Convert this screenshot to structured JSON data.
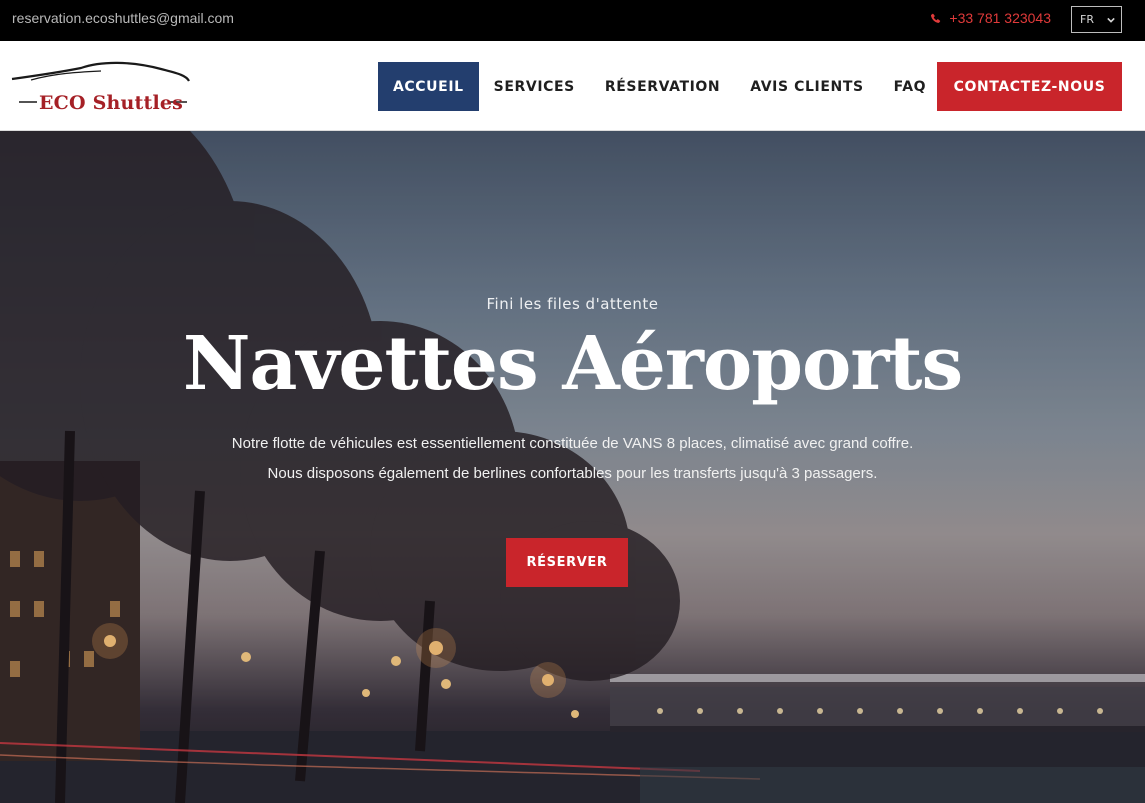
{
  "topbar": {
    "email": "reservation.ecoshuttles@gmail.com",
    "phone": "+33 781 323043",
    "language": "FR"
  },
  "header": {
    "logo_text": "ECO Shuttles",
    "nav": [
      {
        "label": "ACCUEIL",
        "active": true
      },
      {
        "label": "SERVICES",
        "active": false
      },
      {
        "label": "RÉSERVATION",
        "active": false
      },
      {
        "label": "AVIS CLIENTS",
        "active": false
      },
      {
        "label": "FAQ",
        "active": false
      }
    ],
    "contact_label": "CONTACTEZ-NOUS"
  },
  "hero": {
    "eyebrow": "Fini les files d'attente",
    "title": "Navettes Aéroports",
    "description_line1": "Notre flotte de véhicules est essentiellement constituée de VANS 8 places, climatisé avec grand coffre.",
    "description_line2": "Nous disposons également de berlines confortables pour les transferts jusqu'à 3 passagers.",
    "cta_label": "RÉSERVER"
  },
  "colors": {
    "accent_red": "#c9252b",
    "nav_active": "#233e6e",
    "topbar_bg": "#000000"
  },
  "icons": [
    "phone-icon",
    "chevron-down-icon",
    "car-silhouette-icon"
  ]
}
